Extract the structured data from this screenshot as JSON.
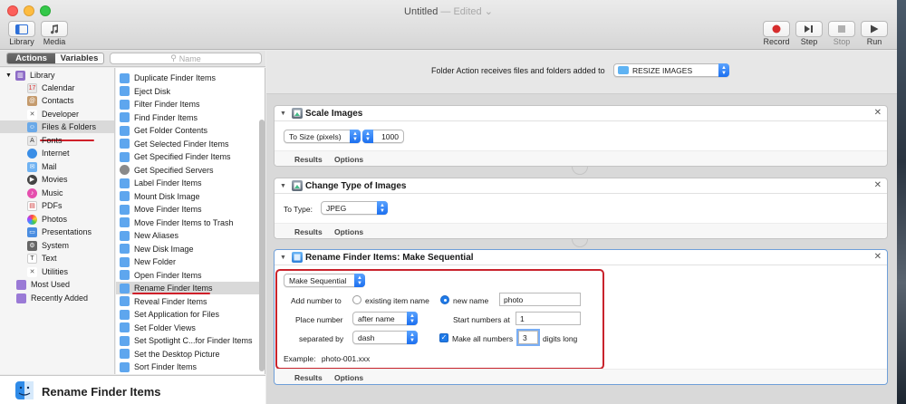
{
  "window": {
    "title": "Untitled",
    "status": "— Edited"
  },
  "toolbar": {
    "library_label": "Library",
    "media_label": "Media",
    "record_label": "Record",
    "step_label": "Step",
    "stop_label": "Stop",
    "run_label": "Run"
  },
  "left_header": {
    "actions_tab": "Actions",
    "variables_tab": "Variables",
    "search_placeholder": "Name"
  },
  "library": {
    "root": "Library",
    "items": [
      "Calendar",
      "Contacts",
      "Developer",
      "Files & Folders",
      "Fonts",
      "Internet",
      "Mail",
      "Movies",
      "Music",
      "PDFs",
      "Photos",
      "Presentations",
      "System",
      "Text",
      "Utilities"
    ],
    "extras": [
      "Most Used",
      "Recently Added"
    ],
    "selected": "Files & Folders"
  },
  "actions_list": {
    "items": [
      "Duplicate Finder Items",
      "Eject Disk",
      "Filter Finder Items",
      "Find Finder Items",
      "Get Folder Contents",
      "Get Selected Finder Items",
      "Get Specified Finder Items",
      "Get Specified Servers",
      "Label Finder Items",
      "Mount Disk Image",
      "Move Finder Items",
      "Move Finder Items to Trash",
      "New Aliases",
      "New Disk Image",
      "New Folder",
      "Open Finder Items",
      "Rename Finder Items",
      "Reveal Finder Items",
      "Set Application for Files",
      "Set Folder Views",
      "Set Spotlight C...for Finder Items",
      "Set the Desktop Picture",
      "Sort Finder Items"
    ],
    "selected": "Rename Finder Items"
  },
  "description": {
    "title": "Rename Finder Items"
  },
  "workflow": {
    "receives_label": "Folder Action receives files and folders added to",
    "folder_name": "RESIZE IMAGES",
    "actions": [
      {
        "title": "Scale Images",
        "popup": "To Size (pixels)",
        "value": "1000",
        "results": "Results",
        "options": "Options"
      },
      {
        "title": "Change Type of Images",
        "type_label": "To Type:",
        "type_value": "JPEG",
        "results": "Results",
        "options": "Options"
      },
      {
        "title": "Rename Finder Items: Make Sequential",
        "mode": "Make Sequential",
        "add_number_label": "Add number to",
        "existing_label": "existing item name",
        "new_name_label": "new name",
        "new_name_value": "photo",
        "place_number_label": "Place number",
        "place_number_value": "after name",
        "start_label": "Start numbers at",
        "start_value": "1",
        "separated_label": "separated by",
        "separated_value": "dash",
        "make_all_label": "Make all numbers",
        "digits_value": "3",
        "digits_label": "digits long",
        "example_label": "Example:",
        "example_value": "photo-001.xxx",
        "results": "Results",
        "options": "Options"
      }
    ]
  },
  "colors": {
    "accent": "#1f7ae8",
    "annotation": "#c9232c",
    "record": "#d62d2d"
  }
}
